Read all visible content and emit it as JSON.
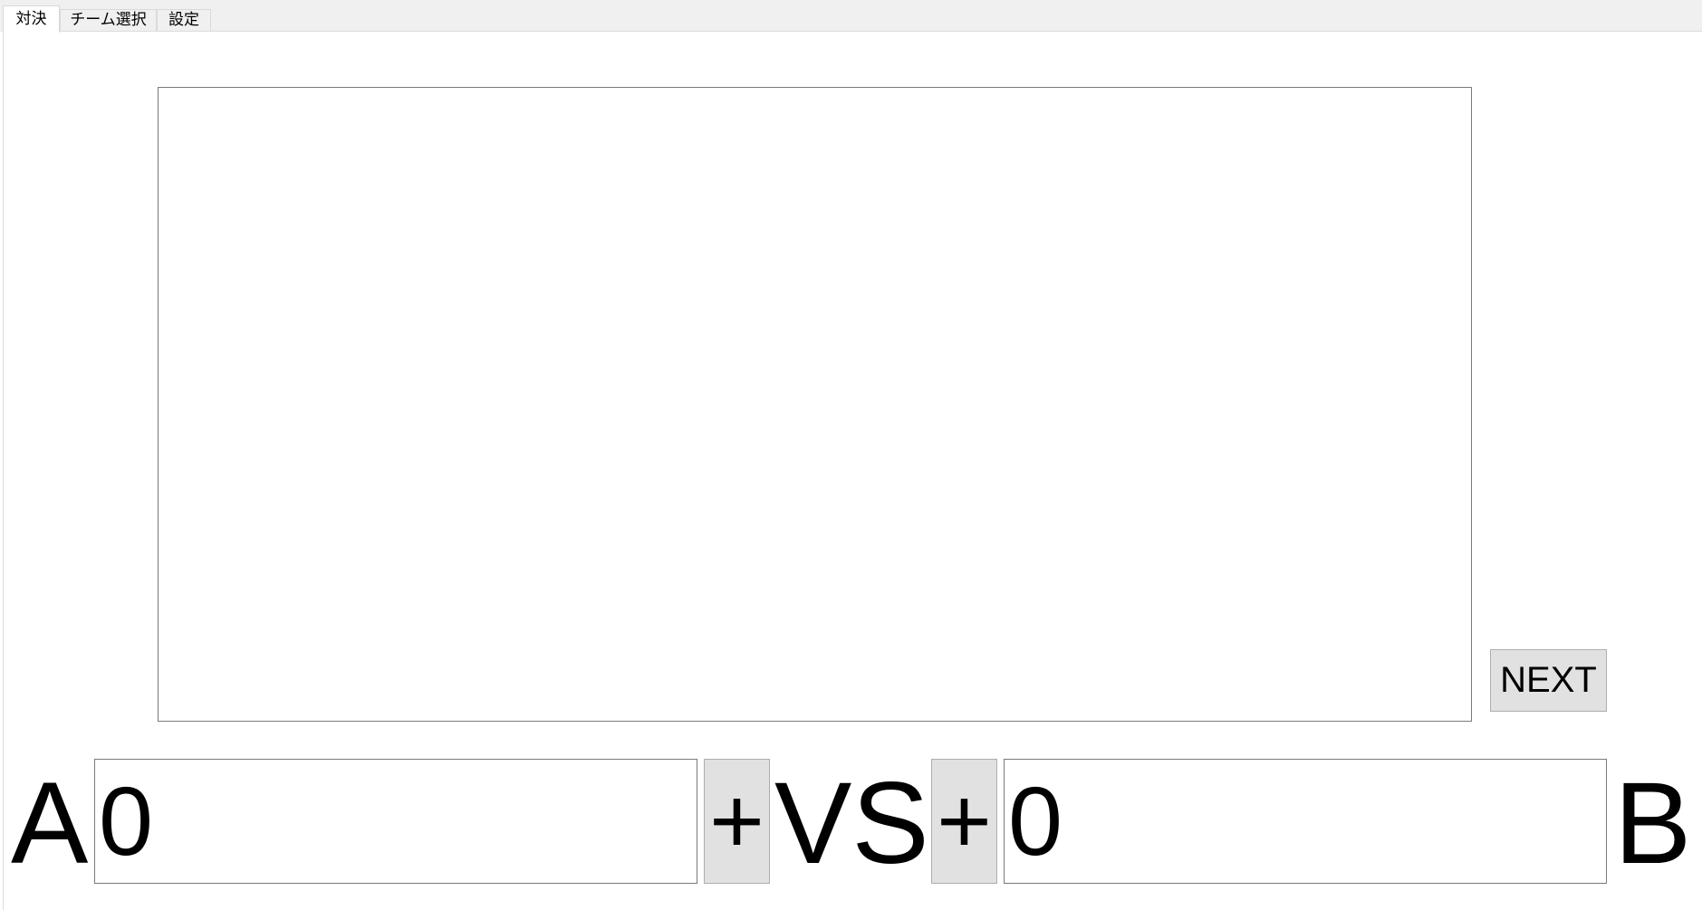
{
  "tabs": [
    {
      "label": "対決"
    },
    {
      "label": "チーム選択"
    },
    {
      "label": "設定"
    }
  ],
  "battle": {
    "next_label": "NEXT",
    "team_a": {
      "label": "A",
      "score": "0",
      "plus_label": "+"
    },
    "vs_label": "VS",
    "team_b": {
      "label": "B",
      "score": "0",
      "plus_label": "+"
    }
  }
}
